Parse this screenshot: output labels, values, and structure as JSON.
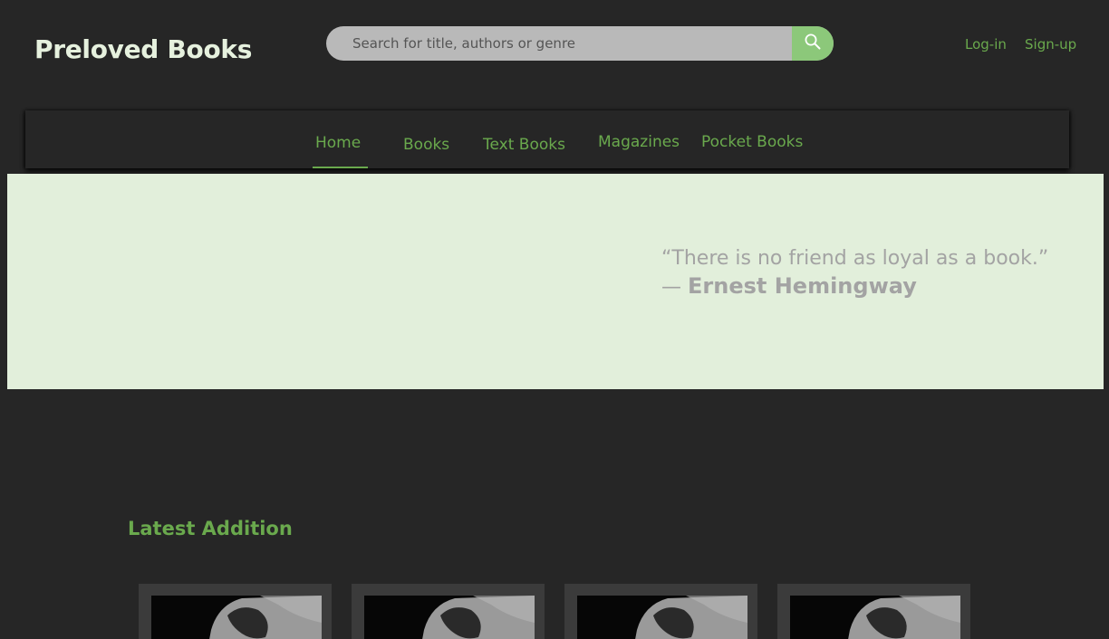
{
  "header": {
    "brand": "Preloved Books",
    "search_placeholder": "Search for title, authors or genre",
    "search_icon": "search-icon",
    "login_label": "Log-in",
    "signup_label": "Sign-up"
  },
  "nav": {
    "items": [
      {
        "label": "Home",
        "active": true
      },
      {
        "label": "Books"
      },
      {
        "label": "Text Books"
      },
      {
        "label": "Magazines"
      },
      {
        "label": "Pocket Books"
      }
    ]
  },
  "hero": {
    "quote": "“There is no friend as loyal as a book.”",
    "dash": "—",
    "author": "Ernest Hemingway"
  },
  "latest": {
    "title": "Latest Addition",
    "cards": [
      {
        "image": "book-cover-image"
      },
      {
        "image": "book-cover-image"
      },
      {
        "image": "book-cover-image"
      },
      {
        "image": "book-cover-image"
      }
    ]
  },
  "colors": {
    "background": "#262626",
    "accent": "#6aa94d",
    "brand_text": "#e6f1de",
    "hero_bg": "#e2efdb",
    "quote_text": "#a3a3a3",
    "search_bg": "#b9b9b9",
    "search_button": "#8cc87a",
    "card_bg": "#3b3b3b"
  }
}
